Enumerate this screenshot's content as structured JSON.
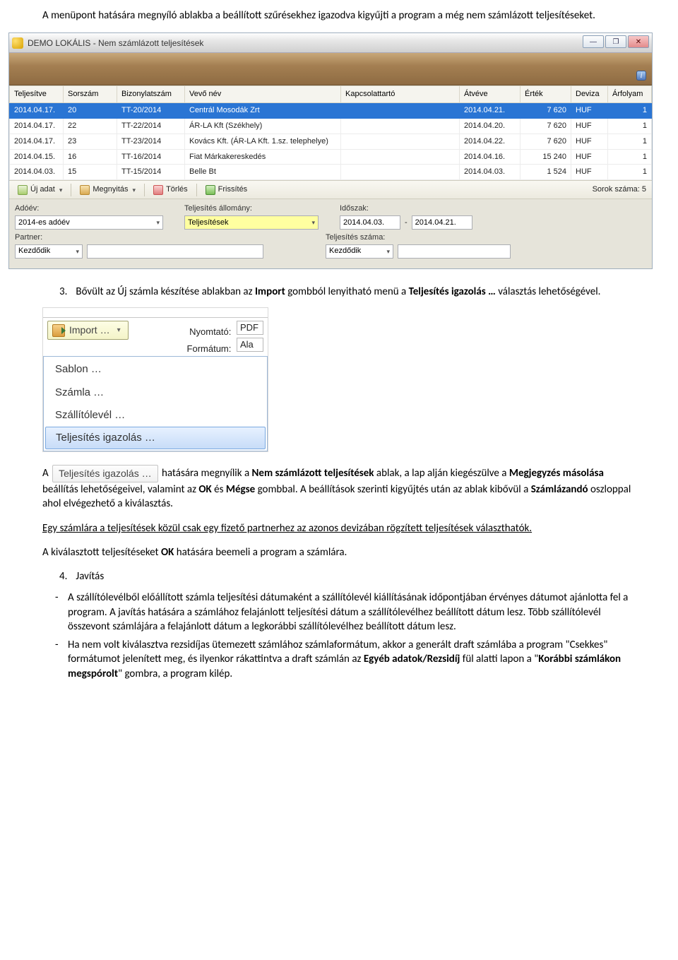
{
  "intro_para": "A menüpont hatására megnyíló ablakba a beállított szűrésekhez igazodva kigyűjti a program a még nem számlázott teljesítéseket.",
  "window1": {
    "title": "DEMO LOKÁLIS - Nem számlázott teljesítések",
    "win_min": "—",
    "win_max": "❐",
    "win_close": "✕",
    "info_glyph": "i",
    "columns": [
      "Teljesítve",
      "Sorszám",
      "Bizonylatszám",
      "Vevő név",
      "Kapcsolattartó",
      "Átvéve",
      "Érték",
      "Deviza",
      "Árfolyam"
    ],
    "rows": [
      {
        "c": [
          "2014.04.17.",
          "20",
          "TT-20/2014",
          "Centrál Mosodák Zrt",
          "",
          "2014.04.21.",
          "7 620",
          "HUF",
          "1"
        ],
        "selected": true
      },
      {
        "c": [
          "2014.04.17.",
          "22",
          "TT-22/2014",
          "ÁR-LA Kft (Székhely)",
          "",
          "2014.04.20.",
          "7 620",
          "HUF",
          "1"
        ]
      },
      {
        "c": [
          "2014.04.17.",
          "23",
          "TT-23/2014",
          "Kovács Kft. (ÁR-LA Kft. 1.sz. telephelye)",
          "",
          "2014.04.22.",
          "7 620",
          "HUF",
          "1"
        ]
      },
      {
        "c": [
          "2014.04.15.",
          "16",
          "TT-16/2014",
          "Fiat Márkakereskedés",
          "",
          "2014.04.16.",
          "15 240",
          "HUF",
          "1"
        ]
      },
      {
        "c": [
          "2014.04.03.",
          "15",
          "TT-15/2014",
          "Belle Bt",
          "",
          "2014.04.03.",
          "1 524",
          "HUF",
          "1"
        ]
      }
    ],
    "toolbar": {
      "new": "Új adat",
      "open": "Megnyitás",
      "delete": "Törlés",
      "refresh": "Frissítés",
      "rowcount": "Sorok száma: 5"
    },
    "filters": {
      "adoev_label": "Adóév:",
      "adoev_value": "2014-es adóév",
      "partner_label": "Partner:",
      "partner_value": "Kezdődik",
      "telj_allomany_label": "Teljesítés állomány:",
      "telj_allomany_value": "Teljesítések",
      "idoszak_label": "Időszak:",
      "idoszak_from": "2014.04.03.",
      "idoszak_sep": "-",
      "idoszak_to": "2014.04.21.",
      "telj_szama_label": "Teljesítés száma:",
      "telj_szama_value": "Kezdődik"
    }
  },
  "item3": {
    "num": "3.",
    "text_pre": "Bővült az Új számla készítése ablakban az ",
    "text_bold1": "Import",
    "text_mid": " gombból lenyitható menü a ",
    "text_bold2": "Teljesítés igazolás …",
    "text_post": " választás lehetőségével."
  },
  "snippet2": {
    "import_label": "Import …",
    "nyomtato_label": "Nyomtató:",
    "nyomtato_value": "PDF",
    "formatum_label": "Formátum:",
    "formatum_value": "Ala",
    "menu_items": [
      "Sablon …",
      "Számla …",
      "Szállítólevél …",
      "Teljesítés igazolás …"
    ]
  },
  "para4": {
    "pre_A": "A ",
    "btn_label": "Teljesítés igazolás …",
    "t1": " hatására megnyílik a ",
    "b1": "Nem számlázott teljesítések",
    "t2": " ablak, a lap alján kiegészülve a ",
    "b2": "Megjegyzés másolása",
    "t3": " beállítás lehetőségeivel, valamint az ",
    "b3": "OK",
    "t4": " és ",
    "b4": "Mégse",
    "t5": " gombbal. A beállítások szerinti kigyűjtés után az ablak kibővül a ",
    "b5": "Számlázandó",
    "t6": " oszloppal ahol elvégezhető a kiválasztás.",
    "u_line": "Egy számlára a teljesítések közül csak egy fizető partnerhez az azonos devizában rögzített teljesítések választhatók.",
    "last_pre": "A kiválasztott teljesítéseket ",
    "last_b": "OK",
    "last_post": " hatására beemeli a program a számlára."
  },
  "item4": {
    "num": "4.",
    "label": "Javítás"
  },
  "bullet1": "A szállítólevélből előállított számla teljesítési dátumaként a szállítólevél kiállításának időpontjában érvényes dátumot ajánlotta fel a program. A javítás hatására a számlához felajánlott teljesítési dátum a szállítólevélhez beállított dátum lesz. Több szállítólevél összevont számlájára a felajánlott dátum a legkorábbi szállítólevélhez beállított dátum lesz.",
  "bullet2": {
    "t1": "Ha nem volt kiválasztva rezsidíjas ütemezett számlához számlaformátum, akkor a generált draft számlába a program \"Csekkes\" formátumot jelenített meg, és ilyenkor rákattintva a draft számlán az ",
    "b1": "Egyéb adatok/Rezsidíj",
    "t2": " fül alatti lapon a \"",
    "b2": "Korábbi számlákon megspórolt",
    "t3": "\" gombra, a program kilép."
  },
  "dash": "-"
}
